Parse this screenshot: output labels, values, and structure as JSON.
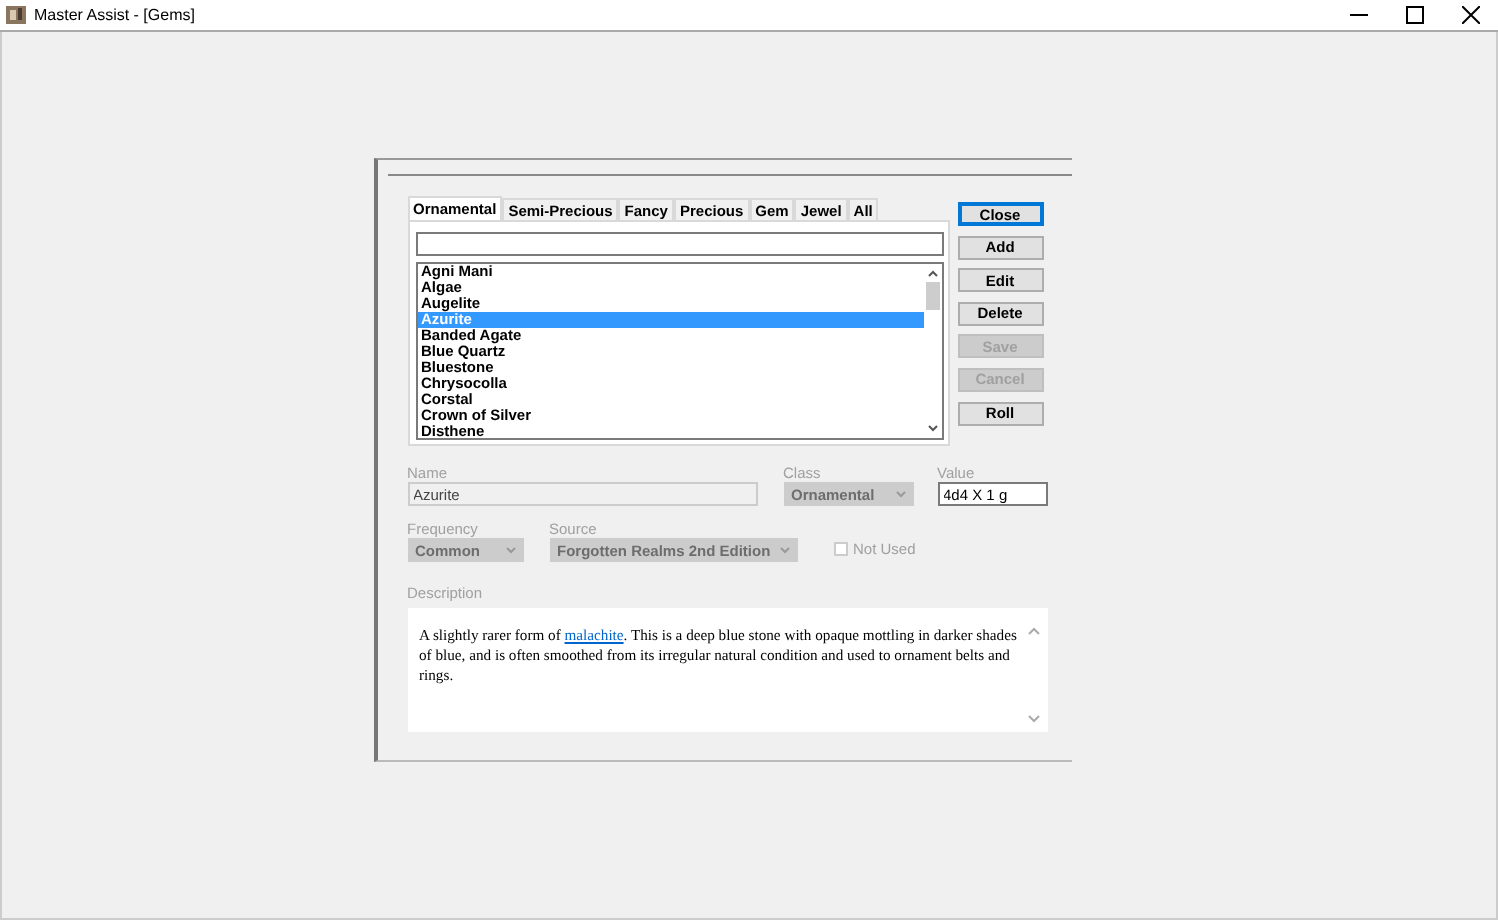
{
  "window": {
    "title": "Master Assist - [Gems]"
  },
  "tabs": [
    {
      "label": "Ornamental",
      "selected": true
    },
    {
      "label": "Semi-Precious",
      "selected": false
    },
    {
      "label": "Fancy",
      "selected": false
    },
    {
      "label": "Precious",
      "selected": false
    },
    {
      "label": "Gem",
      "selected": false
    },
    {
      "label": "Jewel",
      "selected": false
    },
    {
      "label": "All",
      "selected": false
    }
  ],
  "list": {
    "items": [
      {
        "label": "Agni Mani",
        "selected": false
      },
      {
        "label": "Algae",
        "selected": false
      },
      {
        "label": "Augelite",
        "selected": false
      },
      {
        "label": "Azurite",
        "selected": true
      },
      {
        "label": "Banded Agate",
        "selected": false
      },
      {
        "label": "Blue Quartz",
        "selected": false
      },
      {
        "label": "Bluestone",
        "selected": false
      },
      {
        "label": "Chrysocolla",
        "selected": false
      },
      {
        "label": "Corstal",
        "selected": false
      },
      {
        "label": "Crown of Silver",
        "selected": false
      },
      {
        "label": "Disthene",
        "selected": false
      }
    ]
  },
  "buttons": [
    {
      "label": "Close",
      "disabled": false,
      "default": true
    },
    {
      "label": "Add",
      "disabled": false,
      "default": false
    },
    {
      "label": "Edit",
      "disabled": false,
      "default": false
    },
    {
      "label": "Delete",
      "disabled": false,
      "default": false
    },
    {
      "label": "Save",
      "disabled": true,
      "default": false
    },
    {
      "label": "Cancel",
      "disabled": true,
      "default": false
    },
    {
      "label": "Roll",
      "disabled": false,
      "default": false
    }
  ],
  "name": {
    "label": "Name",
    "value": "Azurite",
    "disabled": true
  },
  "class": {
    "label": "Class",
    "value": "Ornamental",
    "disabled": true
  },
  "value": {
    "label": "Value",
    "value": "4d4 X 1 g",
    "disabled": false
  },
  "frequency": {
    "label": "Frequency",
    "value": "Common",
    "disabled": true
  },
  "source": {
    "label": "Source",
    "value": "Forgotten Realms 2nd Edition",
    "disabled": true
  },
  "not_used": {
    "label": "Not Used",
    "checked": false,
    "disabled": true
  },
  "description": {
    "label": "Description",
    "before": "A slightly rarer form of ",
    "link": "malachite",
    "after": ".  This is a deep blue stone with opaque mottling in darker shades of blue, and is often smoothed from its irregular natural condition and used to ornament belts and rings."
  }
}
